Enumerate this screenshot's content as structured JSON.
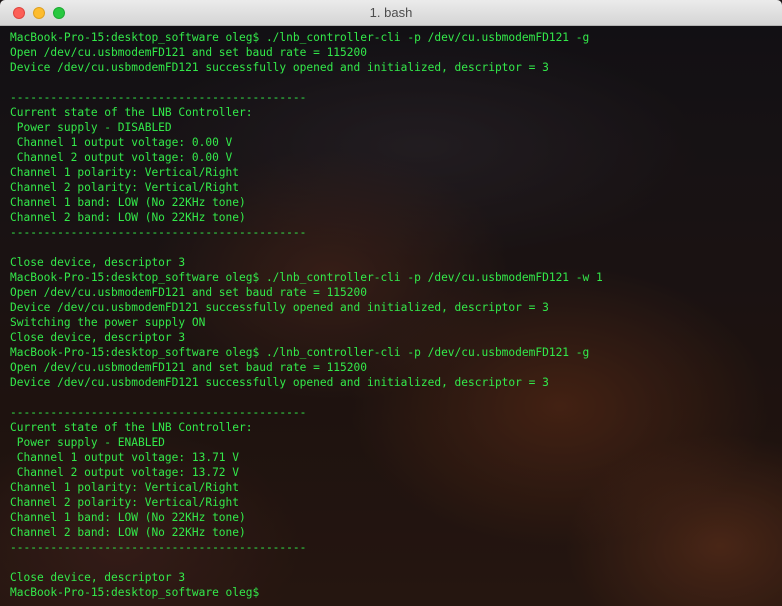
{
  "window": {
    "title": "1. bash"
  },
  "terminal": {
    "text_color": "#33e94a",
    "lines": [
      "MacBook-Pro-15:desktop_software oleg$ ./lnb_controller-cli -p /dev/cu.usbmodemFD121 -g",
      "Open /dev/cu.usbmodemFD121 and set baud rate = 115200",
      "Device /dev/cu.usbmodemFD121 successfully opened and initialized, descriptor = 3",
      "",
      "--------------------------------------------",
      "Current state of the LNB Controller:",
      " Power supply - DISABLED",
      " Channel 1 output voltage: 0.00 V",
      " Channel 2 output voltage: 0.00 V",
      "Channel 1 polarity: Vertical/Right",
      "Channel 2 polarity: Vertical/Right",
      "Channel 1 band: LOW (No 22KHz tone)",
      "Channel 2 band: LOW (No 22KHz tone)",
      "--------------------------------------------",
      "",
      "Close device, descriptor 3",
      "MacBook-Pro-15:desktop_software oleg$ ./lnb_controller-cli -p /dev/cu.usbmodemFD121 -w 1",
      "Open /dev/cu.usbmodemFD121 and set baud rate = 115200",
      "Device /dev/cu.usbmodemFD121 successfully opened and initialized, descriptor = 3",
      "Switching the power supply ON",
      "Close device, descriptor 3",
      "MacBook-Pro-15:desktop_software oleg$ ./lnb_controller-cli -p /dev/cu.usbmodemFD121 -g",
      "Open /dev/cu.usbmodemFD121 and set baud rate = 115200",
      "Device /dev/cu.usbmodemFD121 successfully opened and initialized, descriptor = 3",
      "",
      "--------------------------------------------",
      "Current state of the LNB Controller:",
      " Power supply - ENABLED",
      " Channel 1 output voltage: 13.71 V",
      " Channel 2 output voltage: 13.72 V",
      "Channel 1 polarity: Vertical/Right",
      "Channel 2 polarity: Vertical/Right",
      "Channel 1 band: LOW (No 22KHz tone)",
      "Channel 2 band: LOW (No 22KHz tone)",
      "--------------------------------------------",
      "",
      "Close device, descriptor 3",
      "MacBook-Pro-15:desktop_software oleg$"
    ]
  }
}
